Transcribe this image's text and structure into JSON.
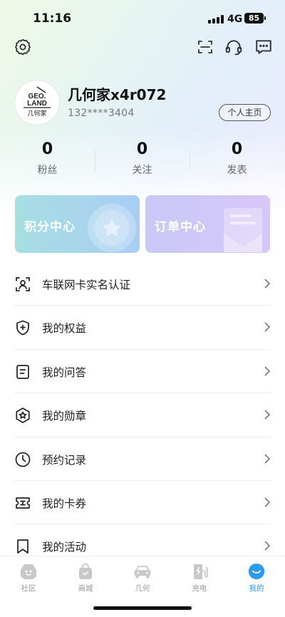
{
  "status_bar": {
    "time": "11:16",
    "network": "4G",
    "battery": "85"
  },
  "header": {
    "settings_icon": "gear-icon",
    "scan_icon": "scan-icon",
    "service_icon": "headset-icon",
    "message_icon": "message-icon"
  },
  "profile": {
    "avatar_logo_top": "GEO.",
    "avatar_logo_mid": "LAND",
    "avatar_logo_cn": "几何家",
    "username": "几何家x4r072",
    "phone": "132****3404",
    "profile_button": "个人主页"
  },
  "stats": [
    {
      "value": "0",
      "label": "粉丝"
    },
    {
      "value": "0",
      "label": "关注"
    },
    {
      "value": "0",
      "label": "发表"
    }
  ],
  "cards": {
    "points": "积分中心",
    "orders": "订单中心"
  },
  "menu": [
    {
      "label": "车联网卡实名认证",
      "icon": "id-card-icon"
    },
    {
      "label": "我的权益",
      "icon": "shield-plus-icon"
    },
    {
      "label": "我的问答",
      "icon": "qa-document-icon"
    },
    {
      "label": "我的勋章",
      "icon": "medal-icon"
    },
    {
      "label": "预约记录",
      "icon": "clock-icon"
    },
    {
      "label": "我的卡券",
      "icon": "coupon-icon"
    },
    {
      "label": "我的活动",
      "icon": "bookmark-icon"
    }
  ],
  "tabs": [
    {
      "label": "社区",
      "icon": "community-icon"
    },
    {
      "label": "商城",
      "icon": "shopping-bag-icon"
    },
    {
      "label": "几何",
      "icon": "car-icon"
    },
    {
      "label": "充电",
      "icon": "charging-station-icon"
    },
    {
      "label": "我的",
      "icon": "profile-face-icon",
      "active": true
    }
  ],
  "colors": {
    "accent": "#2d9bf0",
    "points_card": "#a6dfe3",
    "orders_card": "#c9c8f6"
  }
}
